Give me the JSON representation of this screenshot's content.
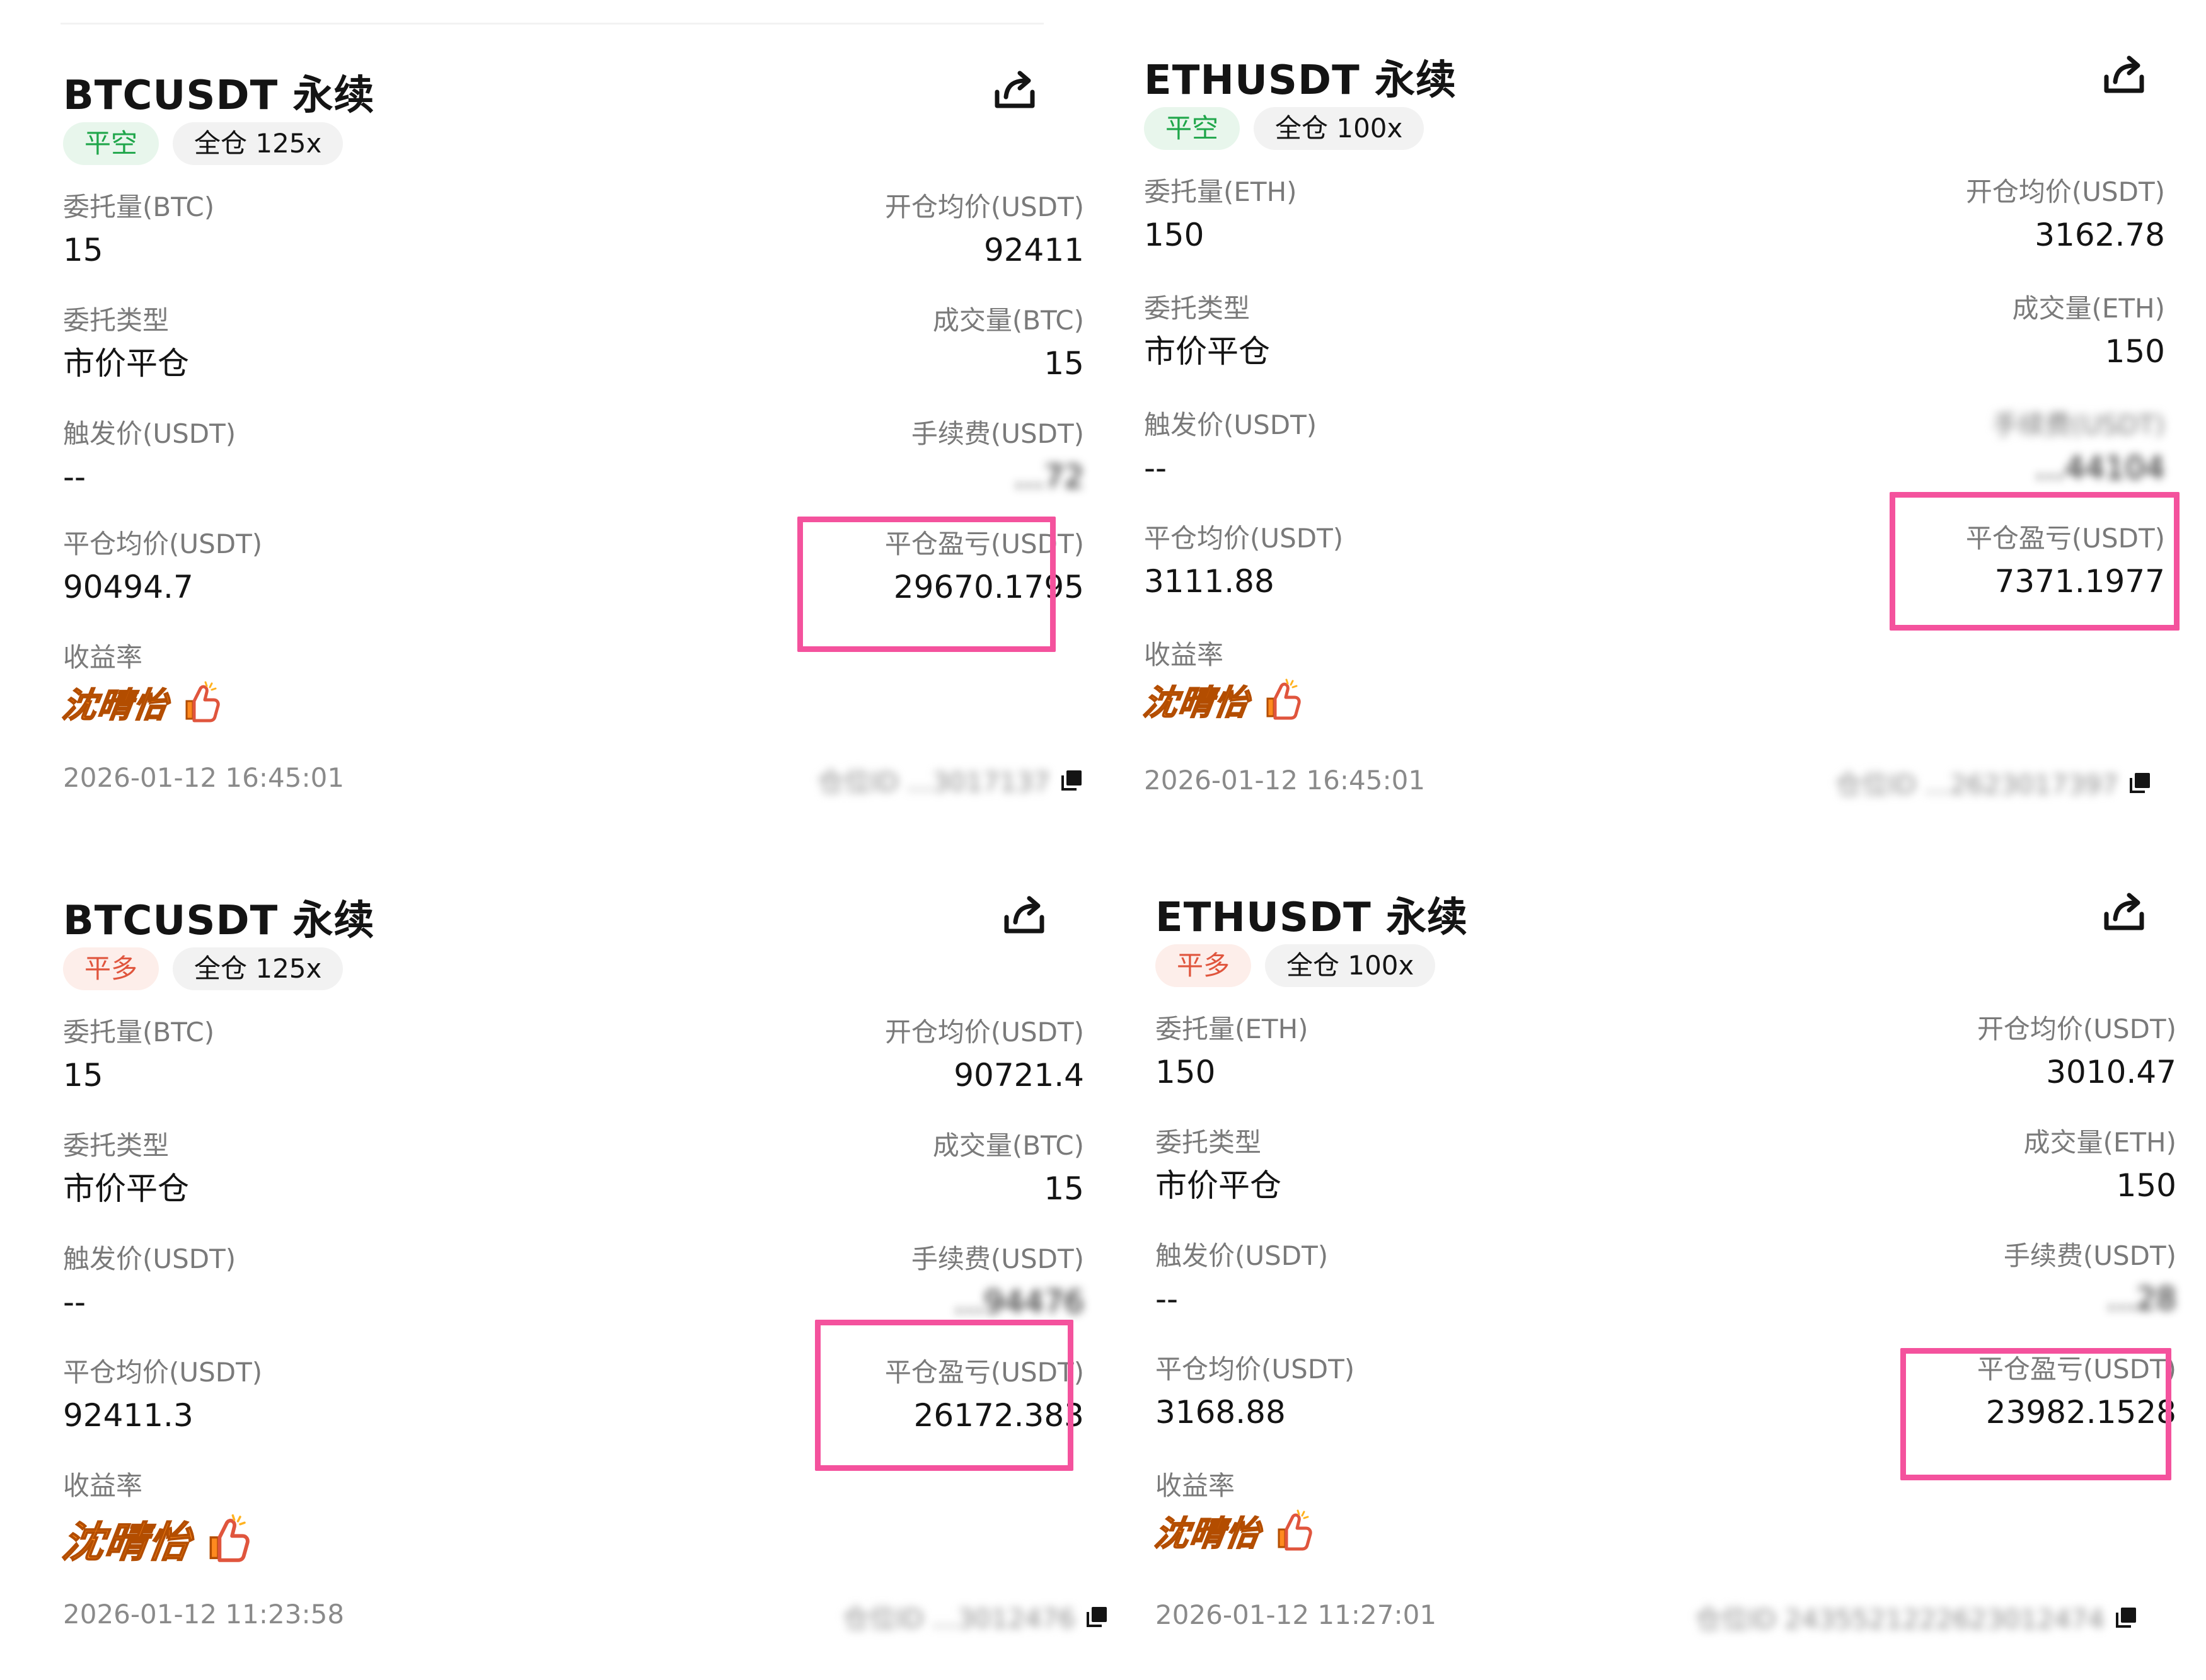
{
  "cards": [
    {
      "title": "BTCUSDT 永续",
      "side_tag": "平空",
      "margin_tag": "全仓 125x",
      "order_qty_label": "委托量(BTC)",
      "order_qty_value": "15",
      "open_avg_label": "开仓均价(USDT)",
      "open_avg_value": "92411",
      "order_type_label": "委托类型",
      "order_type_value": "市价平仓",
      "filled_label": "成交量(BTC)",
      "filled_value": "15",
      "trigger_label": "触发价(USDT)",
      "trigger_value": "--",
      "fee_label": "手续费(USDT)",
      "fee_value": "...72",
      "close_avg_label": "平仓均价(USDT)",
      "close_avg_value": "90494.7",
      "pnl_label": "平仓盈亏(USDT)",
      "pnl_value": "29670.1795",
      "roi_label": "收益率",
      "watermark": "沈晴怡",
      "time": "2026-01-12 16:45:01",
      "position_id": "仓位ID ...3017137"
    },
    {
      "title": "ETHUSDT 永续",
      "side_tag": "平空",
      "margin_tag": "全仓 100x",
      "order_qty_label": "委托量(ETH)",
      "order_qty_value": "150",
      "open_avg_label": "开仓均价(USDT)",
      "open_avg_value": "3162.78",
      "order_type_label": "委托类型",
      "order_type_value": "市价平仓",
      "filled_label": "成交量(ETH)",
      "filled_value": "150",
      "trigger_label": "触发价(USDT)",
      "trigger_value": "--",
      "fee_label": "手续费(USDT)",
      "fee_value": "...44104",
      "close_avg_label": "平仓均价(USDT)",
      "close_avg_value": "3111.88",
      "pnl_label": "平仓盈亏(USDT)",
      "pnl_value": "7371.1977",
      "roi_label": "收益率",
      "watermark": "沈晴怡",
      "time": "2026-01-12 16:45:01",
      "position_id": "仓位ID ...2623017397"
    },
    {
      "title": "BTCUSDT 永续",
      "side_tag": "平多",
      "margin_tag": "全仓 125x",
      "order_qty_label": "委托量(BTC)",
      "order_qty_value": "15",
      "open_avg_label": "开仓均价(USDT)",
      "open_avg_value": "90721.4",
      "order_type_label": "委托类型",
      "order_type_value": "市价平仓",
      "filled_label": "成交量(BTC)",
      "filled_value": "15",
      "trigger_label": "触发价(USDT)",
      "trigger_value": "--",
      "fee_label": "手续费(USDT)",
      "fee_value": "...94476",
      "close_avg_label": "平仓均价(USDT)",
      "close_avg_value": "92411.3",
      "pnl_label": "平仓盈亏(USDT)",
      "pnl_value": "26172.383",
      "roi_label": "收益率",
      "watermark": "沈晴怡",
      "time": "2026-01-12  11:23:58",
      "position_id": "仓位ID ...3012476"
    },
    {
      "title": "ETHUSDT 永续",
      "side_tag": "平多",
      "margin_tag": "全仓 100x",
      "order_qty_label": "委托量(ETH)",
      "order_qty_value": "150",
      "open_avg_label": "开仓均价(USDT)",
      "open_avg_value": "3010.47",
      "order_type_label": "委托类型",
      "order_type_value": "市价平仓",
      "filled_label": "成交量(ETH)",
      "filled_value": "150",
      "trigger_label": "触发价(USDT)",
      "trigger_value": "--",
      "fee_label": "手续费(USDT)",
      "fee_value": "...28",
      "close_avg_label": "平仓均价(USDT)",
      "close_avg_value": "3168.88",
      "pnl_label": "平仓盈亏(USDT)",
      "pnl_value": "23982.1528",
      "roi_label": "收益率",
      "watermark": "沈晴怡",
      "time": "2026-01-12 11:27:01",
      "position_id": "仓位ID 2435521222623012474"
    }
  ],
  "colors": {
    "short_tag_text": "#1fa64a",
    "long_tag_text": "#e0553d",
    "highlight_box": "#f4529d",
    "label_gray": "#7a7a7a"
  },
  "icons": {
    "share": "share-icon",
    "copy": "copy-icon",
    "thumbs_up": "thumbs-up-icon"
  }
}
